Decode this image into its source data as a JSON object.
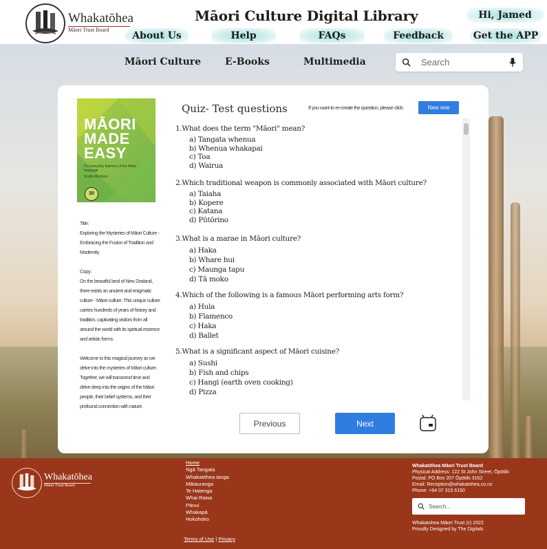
{
  "header": {
    "brand_name": "Whakatōhea",
    "brand_sub": "Māori Trust Board",
    "site_title": "Māori Culture Digital Library",
    "greeting": "Hi, Jamed",
    "nav": [
      "About Us",
      "Help",
      "FAQs",
      "Feedback",
      "Get the APP"
    ],
    "accent_color": "#a8e0e2"
  },
  "subnav": {
    "items": [
      "Māori Culture",
      "E-Books",
      "Multimedia"
    ],
    "search_placeholder": "Search",
    "icons": [
      "search-icon",
      "microphone-icon"
    ]
  },
  "book": {
    "cover": {
      "title_line1": "MĀORI",
      "title_line2": "MADE",
      "title_line3": "EASY",
      "tagline": "For everyday learners of the Māori language",
      "author": "Scotty Morrison",
      "badge": "30"
    },
    "title_label": "Title:",
    "title": "Exploring the Mysteries of Māori Culture - Embracing the Fusion of Tradition and Modernity",
    "copy_label": "Copy:",
    "copy_p1": "On the beautiful land of New Zealand, there exists an ancient and enigmatic culture - Māori culture. This unique culture carries hundreds of years of history and tradition, captivating visitors from all around the world with its spiritual essence and artistic forms.",
    "copy_p2": "Welcome to this magical journey as we delve into the mysteries of Māori culture. Together, we will transcend time and delve deep into the origins of the Māori people, their belief systems, and their profound connection with nature."
  },
  "quiz": {
    "title": "Quiz- Test questions",
    "recreate_text": "If you want to re-create the question, please click:",
    "new_button": "New one",
    "questions": [
      {
        "text": "1.What does the term \"Māori\" mean?",
        "options": [
          "a) Tangata whenua",
          "b) Whenua whakapai",
          "c) Toa",
          "d) Wairua"
        ]
      },
      {
        "text": "2.Which traditional weapon is commonly associated with Māori culture?",
        "options": [
          "a) Taiaha",
          "b) Kopere",
          "c) Katana",
          "d) Pūtōrino"
        ]
      },
      {
        "text": "3.What is a marae in Māori culture?",
        "options": [
          "a) Haka",
          "b) Whare hui",
          "c) Maunga tapu",
          "d) Tā moko"
        ]
      },
      {
        "text": "4.Which of the following is a famous Māori performing arts form?",
        "options": [
          "a) Hula",
          "b) Flamenco",
          "c) Haka",
          "d) Ballet"
        ]
      },
      {
        "text": "5.What is a significant aspect of Māori cuisine?",
        "options": [
          "a) Sushi",
          "b) Fish and chips",
          "c) Hangi (earth oven cooking)",
          "d) Pizza"
        ]
      }
    ],
    "previous_button": "Previous",
    "next_button": "Next",
    "primary_color": "#2f7de1"
  },
  "footer": {
    "brand_name": "Whakatōhea",
    "brand_sub": "Māori Trust Board",
    "links": [
      "Home",
      "Ngā Tangata",
      "Whakatōhea tanga",
      "Mātauranga",
      "Te Hatenga",
      "Whai Rawa",
      "Pānui",
      "Whakapā",
      "Hokohoko"
    ],
    "terms": "Terms of Use",
    "separator": "|",
    "privacy": "Privacy",
    "org_name": "Whakatōhea Māori Trust Board",
    "physical": "Physical Address: 122 St John Street, Ōpōtiki",
    "postal": "Postal: PO Box 207 Ōpōtiki 3162",
    "email": "Email: Reception@whakatohea.co.nz",
    "phone": "Phone: +64 07 315 6150",
    "search_placeholder": "Search...",
    "copyright": "Whakatohea Māori Trust (c) 2022",
    "credit": "Proudly Designed by The Digitals",
    "color": "#9a361a"
  }
}
